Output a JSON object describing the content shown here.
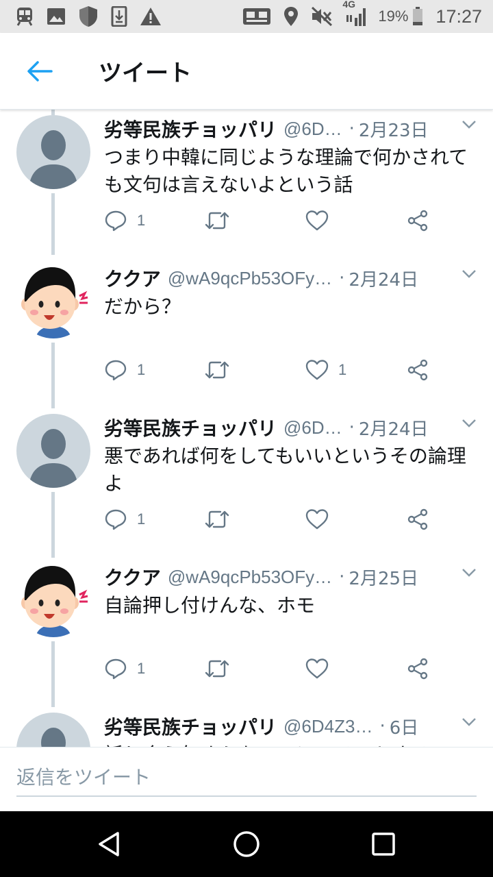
{
  "status_bar": {
    "battery": "19%",
    "time": "17:27",
    "network": "4G",
    "icons_left": [
      "train-icon",
      "image-icon",
      "shield-icon",
      "download-icon",
      "warning-icon"
    ],
    "icons_right": [
      "cast-icon",
      "location-icon",
      "mute-icon",
      "signal-icon",
      "battery-icon"
    ]
  },
  "header": {
    "title": "ツイート"
  },
  "tweets": [
    {
      "name": "劣等民族チョッパリ",
      "handle": "@6D…",
      "dot": "·",
      "date": "2月23日",
      "text": "つまり中韓に同じような理論で何かされても文句は言えないよという話",
      "replies": "1",
      "retweets": "",
      "likes": "",
      "avatar": "default"
    },
    {
      "name": "ククア",
      "handle": "@wA9qcPb53OFy…",
      "dot": "·",
      "date": "2月24日",
      "text": "だから？",
      "replies": "1",
      "retweets": "",
      "likes": "1",
      "avatar": "kid"
    },
    {
      "name": "劣等民族チョッパリ",
      "handle": "@6D…",
      "dot": "·",
      "date": "2月24日",
      "text": "悪であれば何をしてもいいというその論理よ",
      "replies": "1",
      "retweets": "",
      "likes": "",
      "avatar": "default"
    },
    {
      "name": "ククア",
      "handle": "@wA9qcPb53OFy…",
      "dot": "·",
      "date": "2月25日",
      "text": "自論押し付けんな、ホモ",
      "replies": "1",
      "retweets": "",
      "likes": "",
      "avatar": "kid"
    },
    {
      "name": "劣等民族チョッパリ",
      "handle": "@6D4Z3…",
      "dot": "·",
      "date": "6日",
      "text": "話し合う気すらないのにコメントするの",
      "replies": "",
      "retweets": "",
      "likes": "",
      "avatar": "default"
    }
  ],
  "reply": {
    "placeholder": "返信をツイート"
  },
  "colors": {
    "accent": "#1da1f2",
    "muted": "#657786",
    "thread_line": "#ccd6dd",
    "status_bg": "#e8e8e8"
  }
}
